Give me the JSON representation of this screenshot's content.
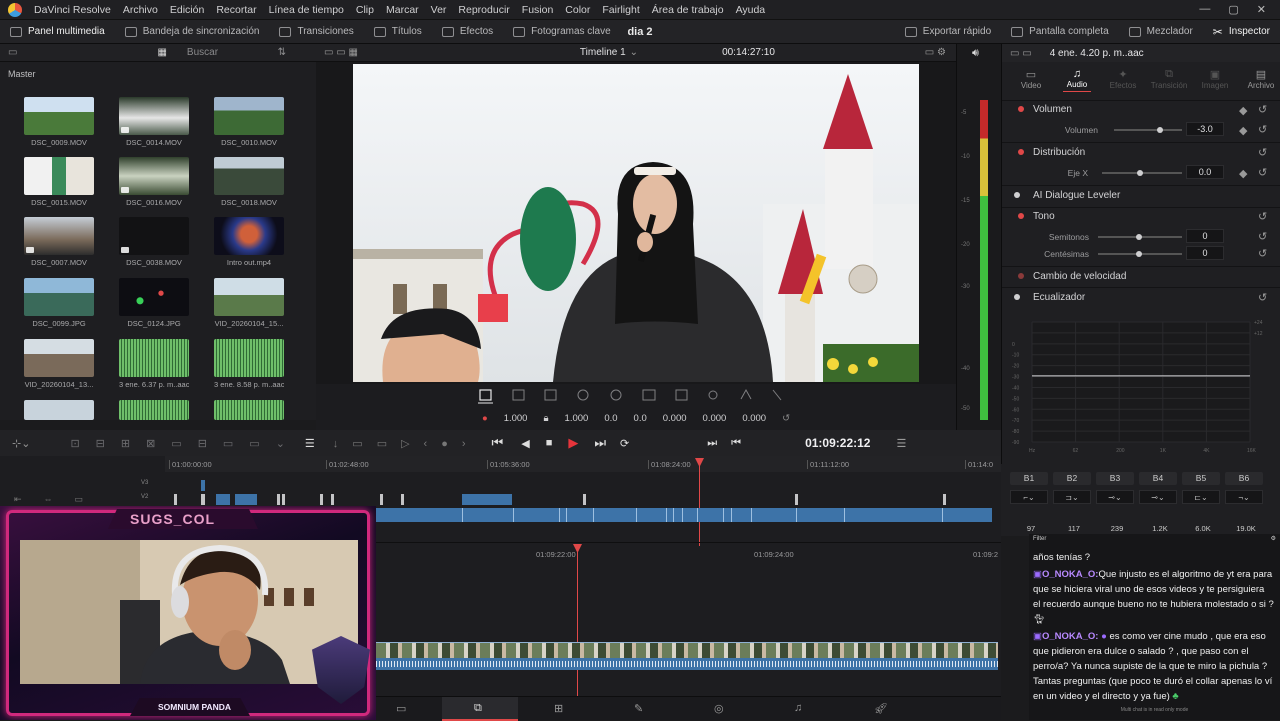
{
  "menubar": {
    "app": "DaVinci Resolve",
    "items": [
      "Archivo",
      "Edición",
      "Recortar",
      "Línea de tiempo",
      "Clip",
      "Marcar",
      "Ver",
      "Reproducir",
      "Fusion",
      "Color",
      "Fairlight",
      "Área de trabajo",
      "Ayuda"
    ]
  },
  "toolbar": {
    "left": [
      "Panel multimedia",
      "Bandeja de sincronización",
      "Transiciones",
      "Títulos",
      "Efectos",
      "Fotogramas clave"
    ],
    "project_title": "dia 2",
    "right": [
      "Exportar rápido",
      "Pantalla completa",
      "Mezclador",
      "Inspector"
    ]
  },
  "media_pool": {
    "search_placeholder": "Buscar",
    "bin": "Master",
    "clips": [
      {
        "name": "DSC_0009.MOV"
      },
      {
        "name": "DSC_0014.MOV"
      },
      {
        "name": "DSC_0010.MOV"
      },
      {
        "name": "DSC_0015.MOV"
      },
      {
        "name": "DSC_0016.MOV"
      },
      {
        "name": "DSC_0018.MOV"
      },
      {
        "name": "DSC_0007.MOV"
      },
      {
        "name": "DSC_0038.MOV"
      },
      {
        "name": "Intro out.mp4"
      },
      {
        "name": "DSC_0099.JPG"
      },
      {
        "name": "DSC_0124.JPG"
      },
      {
        "name": "VID_20260104_15..."
      },
      {
        "name": "VID_20260104_13..."
      },
      {
        "name": "3 ene. 6.37 p. m..aac"
      },
      {
        "name": "3 ene. 8.58 p. m..aac"
      }
    ]
  },
  "viewer": {
    "timeline_name": "Timeline 1",
    "timecode": "00:14:27:10",
    "values": {
      "zoom_x": "1.000",
      "zoom_y": "1.000",
      "pos_x": "0.0",
      "pos_y": "0.0",
      "rotation": "0.000",
      "crop1": "0.000",
      "crop2": "0.000"
    }
  },
  "meters": {
    "scale": [
      "-5",
      "-10",
      "-15",
      "-20",
      "-30",
      "-40",
      "-50"
    ]
  },
  "inspector": {
    "clip_name": "4 ene. 4.20 p. m..aac",
    "tabs": [
      "Video",
      "Audio",
      "Efectos",
      "Transición",
      "Imagen",
      "Archivo"
    ],
    "active_tab": "Audio",
    "volume": {
      "label": "Volumen",
      "sub": "Volumen",
      "value": "-3.0"
    },
    "distribution": {
      "label": "Distribución",
      "sub": "Eje X",
      "value": "0.0"
    },
    "ai_leveler": "AI Dialogue Leveler",
    "tone": {
      "label": "Tono",
      "semitones_label": "Semitonos",
      "semitones": "0",
      "cents_label": "Centésimas",
      "cents": "0"
    },
    "speed": "Cambio de velocidad",
    "eq": "Ecualizador",
    "eq_y": [
      "+24",
      "+12",
      "0",
      "-10",
      "-20",
      "-30",
      "-40",
      "-50",
      "-60",
      "-70",
      "-80",
      "-90"
    ],
    "eq_x": [
      "Hz",
      "62",
      "200",
      "1K",
      "4K",
      "16K"
    ],
    "bands": [
      "B1",
      "B2",
      "B3",
      "B4",
      "B5",
      "B6"
    ],
    "band_values": [
      "97",
      "117",
      "239",
      "1.2K",
      "6.0K",
      "19.0K"
    ]
  },
  "transport": {
    "timecode": "01:09:22:12"
  },
  "timeline": {
    "ruler": [
      "01:00:00:00",
      "01:02:48:00",
      "01:05:36:00",
      "01:08:24:00",
      "01:11:12:00",
      "01:14:0"
    ],
    "ruler2": [
      "01:09:22:00",
      "01:09:24:00",
      "01:09:2"
    ],
    "tracks": [
      "V3",
      "V2"
    ]
  },
  "webcam": {
    "channel": "SUGS_COL",
    "tagline": "SOMNIUM PANDA"
  },
  "chat": {
    "filter": "Filter",
    "messages": [
      {
        "user": "",
        "text": "años tenías ?"
      },
      {
        "user": "O_NOKA_O:",
        "text": "Que injusto es el algoritmo de yt era para que se hiciera viral uno de esos videos y te persiguiera el recuerdo aunque bueno no te hubiera molestado o si ?"
      },
      {
        "user": "O_NOKA_O:",
        "text": "es como ver cine mudo , que era eso que pidieron era dulce o salado ? , que paso con el perro/a? Ya nunca supiste de la que te miro la pichula ? Tantas preguntas (que poco te duró el collar apenas lo ví en un video y el directo y ya fue)"
      }
    ],
    "footer": "Multi chat is in read only mode"
  },
  "colors": {
    "accent_red": "#e04848",
    "clip_blue": "#3d73a8",
    "audio_green": "#62b85f",
    "overlay_magenta": "#d0297d"
  }
}
